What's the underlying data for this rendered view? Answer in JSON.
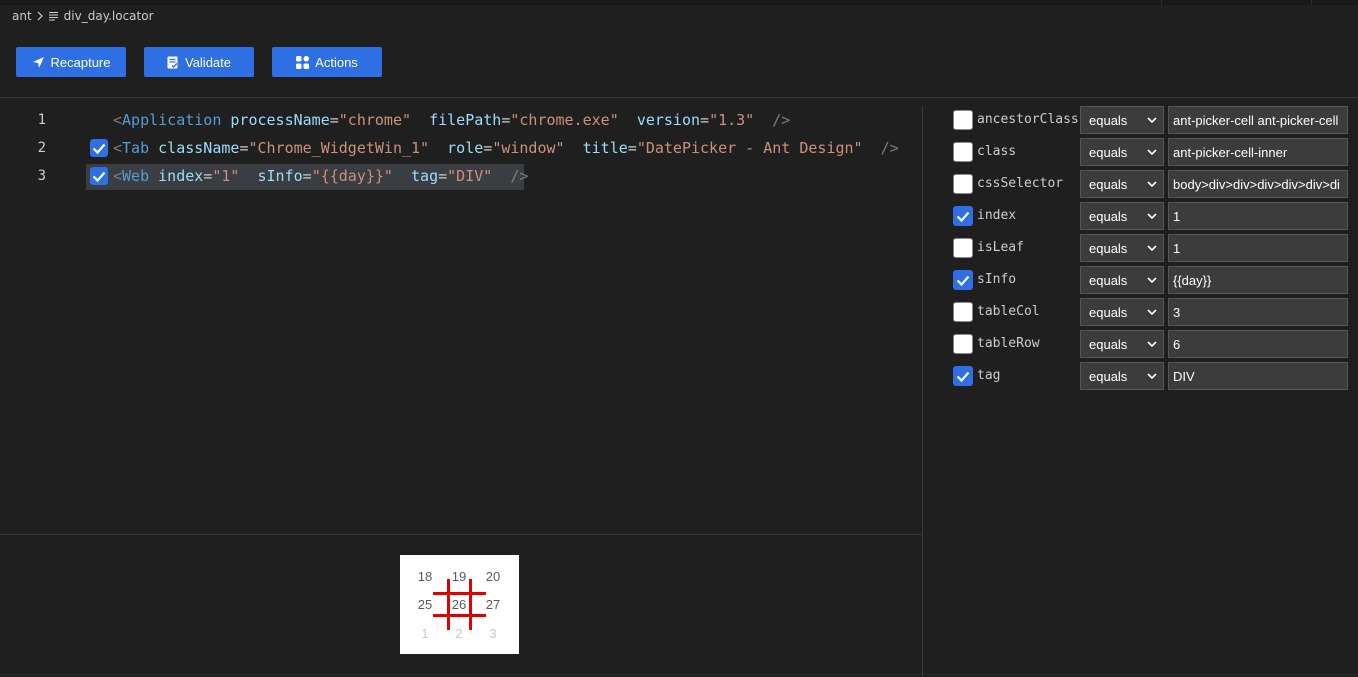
{
  "breadcrumb": {
    "root": "ant",
    "file": "div_day.locator"
  },
  "toolbar": {
    "recapture_label": "Recapture",
    "validate_label": "Validate",
    "actions_label": "Actions"
  },
  "editor": {
    "lines": [
      {
        "number": "1",
        "checked": false,
        "tag": "Application",
        "attrs": [
          {
            "name": "processName",
            "value": "\"chrome\""
          },
          {
            "name": "filePath",
            "value": "\"chrome.exe\""
          },
          {
            "name": "version",
            "value": "\"1.3\""
          }
        ]
      },
      {
        "number": "2",
        "checked": true,
        "tag": "Tab",
        "attrs": [
          {
            "name": "className",
            "value": "\"Chrome_WidgetWin_1\""
          },
          {
            "name": "role",
            "value": "\"window\""
          },
          {
            "name": "title",
            "value": "\"DatePicker - Ant Design\""
          }
        ]
      },
      {
        "number": "3",
        "checked": true,
        "tag": "Web",
        "attrs": [
          {
            "name": "index",
            "value": "\"1\""
          },
          {
            "name": "sInfo",
            "value": "\"{{day}}\""
          },
          {
            "name": "tag",
            "value": "\"DIV\""
          }
        ]
      }
    ]
  },
  "properties": [
    {
      "name": "ancestorClass",
      "checked": false,
      "operator": "equals",
      "value": "ant-picker-cell ant-picker-cell"
    },
    {
      "name": "class",
      "checked": false,
      "operator": "equals",
      "value": "ant-picker-cell-inner"
    },
    {
      "name": "cssSelector",
      "checked": false,
      "operator": "equals",
      "value": "body>div>div>div>div>div>di"
    },
    {
      "name": "index",
      "checked": true,
      "operator": "equals",
      "value": "1"
    },
    {
      "name": "isLeaf",
      "checked": false,
      "operator": "equals",
      "value": "1"
    },
    {
      "name": "sInfo",
      "checked": true,
      "operator": "equals",
      "value": "{{day}}"
    },
    {
      "name": "tableCol",
      "checked": false,
      "operator": "equals",
      "value": "3"
    },
    {
      "name": "tableRow",
      "checked": false,
      "operator": "equals",
      "value": "6"
    },
    {
      "name": "tag",
      "checked": true,
      "operator": "equals",
      "value": "DIV"
    }
  ],
  "preview": {
    "rows": [
      [
        "18",
        "19",
        "20"
      ],
      [
        "25",
        "26",
        "27"
      ],
      [
        "1",
        "2",
        "3"
      ]
    ]
  },
  "colors": {
    "accent": "#2f6fe4",
    "background": "#1f1f1f",
    "highlight": "#e00000"
  }
}
